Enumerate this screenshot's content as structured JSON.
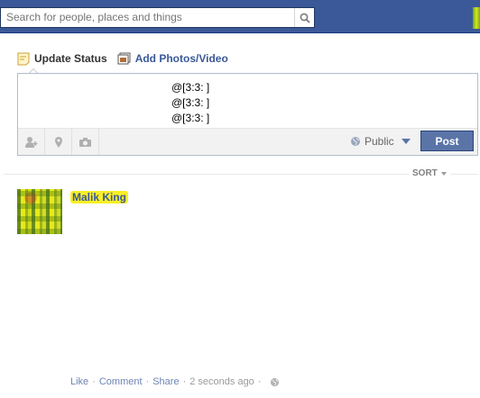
{
  "header": {
    "search": {
      "placeholder": "Search for people, places and things",
      "icon": "search-icon"
    },
    "avatar_icon": "profile-thumbnail"
  },
  "composer": {
    "tabs": [
      {
        "label": "Update Status",
        "icon": "status-icon"
      },
      {
        "label": "Add Photos/Video",
        "icon": "photo-icon"
      }
    ],
    "text_lines": [
      "@[3:3: ]",
      "@[3:3: ]",
      "@[3:3: ]"
    ],
    "footer_icons": [
      "tag-friends-icon",
      "location-icon",
      "camera-icon"
    ],
    "privacy": {
      "label": "Public",
      "icon": "globe-icon"
    },
    "post_label": "Post"
  },
  "feed": {
    "sort_label": "SORT",
    "story": {
      "author": "Malik King",
      "actions": [
        "Like",
        "Comment",
        "Share"
      ],
      "timestamp": "2 seconds ago",
      "audience_icon": "globe-icon"
    }
  },
  "colors": {
    "brand_blue": "#3b5998",
    "post_button": "#5b74a8",
    "link": "#6d84b4"
  }
}
